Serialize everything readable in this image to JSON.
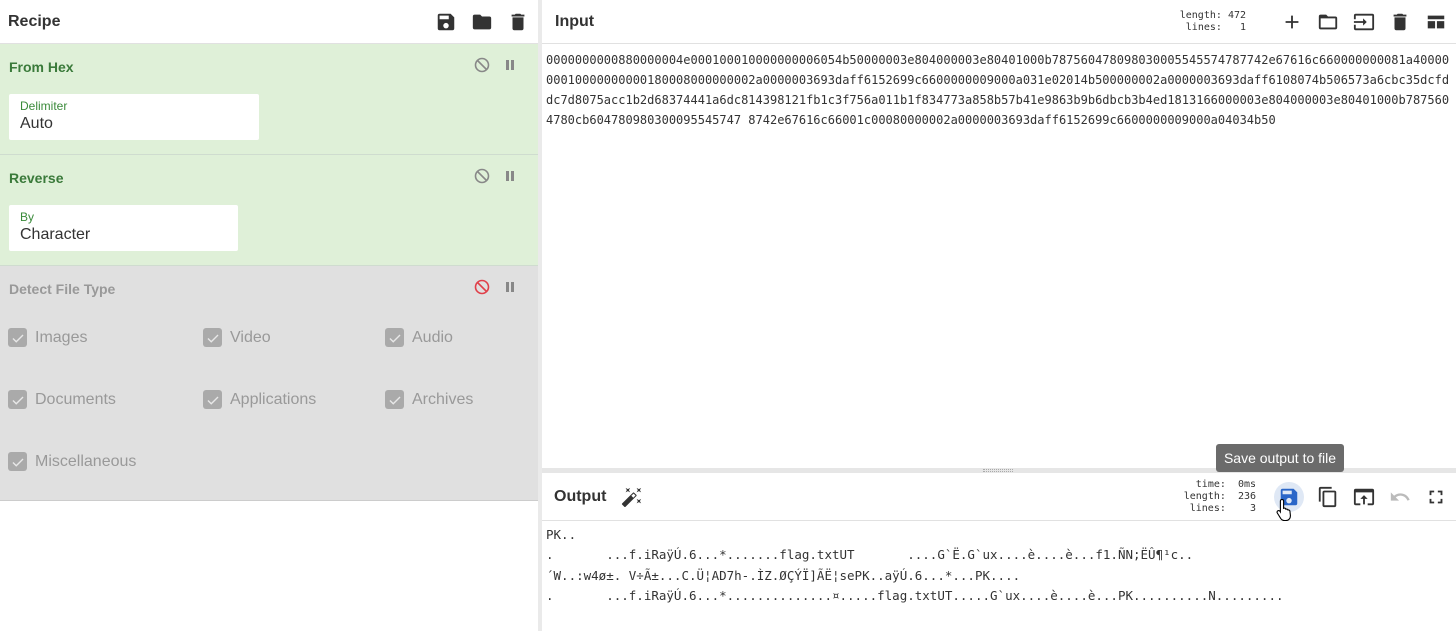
{
  "recipe": {
    "title": "Recipe",
    "operations": [
      {
        "title": "From Hex",
        "arg_label": "Delimiter",
        "arg_value": "Auto"
      },
      {
        "title": "Reverse",
        "arg_label": "By",
        "arg_value": "Character"
      },
      {
        "title": "Detect File Type",
        "disabled": true,
        "checkboxes": [
          "Images",
          "Video",
          "Audio",
          "Documents",
          "Applications",
          "Archives",
          "Miscellaneous"
        ]
      }
    ]
  },
  "input": {
    "title": "Input",
    "length_label": "length:",
    "length_value": "472",
    "lines_label": "lines:",
    "lines_value": "1",
    "text": "0000000000880000004e000100010000000006054b50000003e804000003e80401000b787560478098030005545574787742e67616c660000000081a4000000010000000000180008000000002a0000003693daff6152699c6600000009000a031e02014b500000002a0000003693daff6108074b506573a6cbc35dcfddc7d8075acc1b2d68374441a6dc814398121fb1c3f756a011b1f834773a858b57b41e9863b9b6dbcb3b4ed1813166000003e804000003e80401000b7875604780cb604780980300095545747 8742e67616c66001c00080000002a0000003693daff6152699c6600000009000a04034b50"
  },
  "output": {
    "title": "Output",
    "time_label": "time:",
    "time_value": "0ms",
    "length_label": "length:",
    "length_value": "236",
    "lines_label": "lines:",
    "lines_value": "3",
    "tooltip": "Save output to file",
    "text": "PK..\n.       ...f.iRaÿÚ.6...*.......flag.txtUT       ....G`Ë.G`ux....è....è...f1.ÑN;ËÛ¶¹c..\n´W..:w4ø±. V÷Ã±...C.Ü¦AD7h-.ÌZ.ØÇÝÏ]ÃË¦sePK..aÿÚ.6...*...PK....\n.       ...f.iRaÿÚ.6...*..............¤.....flag.txtUT.....G`ux....è....è...PK..........N........."
  },
  "colors": {
    "accent_green": "#dff0d8",
    "disabled_grey": "#e0e0e0",
    "save_blue": "#2a66c8"
  }
}
